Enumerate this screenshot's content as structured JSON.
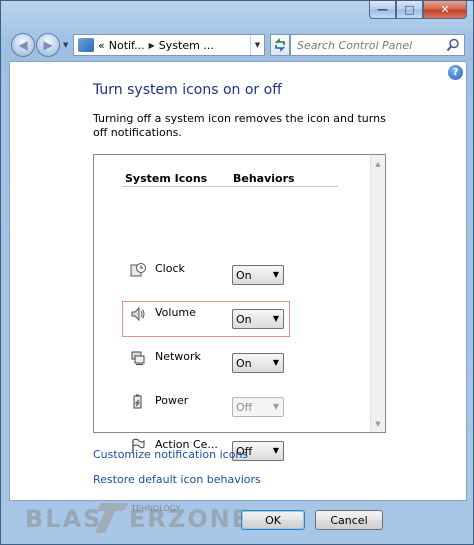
{
  "window": {
    "caption_buttons": {
      "minimize": "—",
      "maximize": "□",
      "close": "✕"
    }
  },
  "address_bar": {
    "segments": [
      "Notif...",
      "System ..."
    ],
    "overflow_marker": "«",
    "search_placeholder": "Search Control Panel"
  },
  "page": {
    "title": "Turn system icons on or off",
    "description": "Turning off a system icon removes the icon and turns off notifications."
  },
  "table": {
    "headers": {
      "icons": "System Icons",
      "behaviors": "Behaviors"
    },
    "rows": [
      {
        "label": "Clock",
        "value": "On",
        "icon": "clock-icon",
        "enabled": true
      },
      {
        "label": "Volume",
        "value": "On",
        "icon": "volume-icon",
        "enabled": true,
        "highlighted": true
      },
      {
        "label": "Network",
        "value": "On",
        "icon": "network-icon",
        "enabled": true
      },
      {
        "label": "Power",
        "value": "Off",
        "icon": "power-icon",
        "enabled": false
      },
      {
        "label": "Action Ce...",
        "value": "Off",
        "icon": "flag-icon",
        "enabled": true
      }
    ]
  },
  "links": {
    "customize": "Customize notification icons",
    "restore": "Restore default icon behaviors"
  },
  "buttons": {
    "ok": "OK",
    "cancel": "Cancel"
  },
  "watermark": {
    "main": "BLAST ERZONE",
    "sub": "TEHNOLOGY"
  },
  "colors": {
    "title": "#1e3287",
    "link": "#1c50a8",
    "highlight_border": "#e8908a"
  }
}
